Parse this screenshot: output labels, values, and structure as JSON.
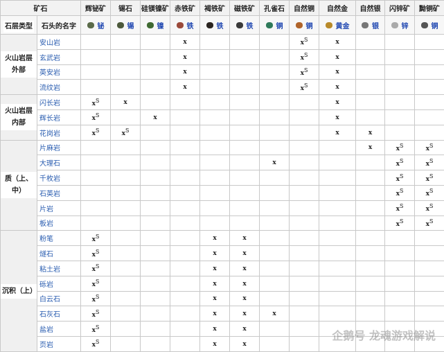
{
  "header": {
    "ore_label": "矿石",
    "ores": [
      "辉铋矿",
      "锡石",
      "硅镁镍矿",
      "赤铁矿",
      "褐铁矿",
      "磁铁矿",
      "孔雀石",
      "自然铜",
      "自然金",
      "自然银",
      "闪锌矿",
      "黝铜矿"
    ]
  },
  "subheader": {
    "layer_type": "石层类型",
    "rock_name": "石头的名字",
    "metals": [
      "铋",
      "锡",
      "镍",
      "铁",
      "铁",
      "铁",
      "铜",
      "铜",
      "黄金",
      "银",
      "锌",
      "铜"
    ],
    "icon_colors": [
      "#5b6b4a",
      "#4d5a3c",
      "#3f6a32",
      "#9b4a3a",
      "#2a2420",
      "#3a3a3a",
      "#2f7a5a",
      "#b0642a",
      "#b88a2a",
      "#777",
      "#aaa",
      "#555"
    ]
  },
  "groups": [
    {
      "label": "火山岩层外部",
      "rows": [
        {
          "name": "安山岩",
          "marks": [
            "",
            "",
            "",
            "x",
            "",
            "",
            "",
            "xS",
            "x",
            "",
            "",
            ""
          ]
        },
        {
          "name": "玄武岩",
          "marks": [
            "",
            "",
            "",
            "x",
            "",
            "",
            "",
            "xS",
            "x",
            "",
            "",
            ""
          ]
        },
        {
          "name": "英安岩",
          "marks": [
            "",
            "",
            "",
            "x",
            "",
            "",
            "",
            "xS",
            "x",
            "",
            "",
            ""
          ]
        },
        {
          "name": "流纹岩",
          "marks": [
            "",
            "",
            "",
            "x",
            "",
            "",
            "",
            "xS",
            "x",
            "",
            "",
            ""
          ]
        }
      ]
    },
    {
      "label": "火山岩层内部",
      "rows": [
        {
          "name": "闪长岩",
          "marks": [
            "xS",
            "x",
            "",
            "",
            "",
            "",
            "",
            "",
            "x",
            "",
            "",
            ""
          ]
        },
        {
          "name": "辉长岩",
          "marks": [
            "xS",
            "",
            "x",
            "",
            "",
            "",
            "",
            "",
            "x",
            "",
            "",
            ""
          ]
        },
        {
          "name": "花岗岩",
          "marks": [
            "xS",
            "xS",
            "",
            "",
            "",
            "",
            "",
            "",
            "x",
            "x",
            "",
            ""
          ]
        }
      ]
    },
    {
      "label": "质（上、中）",
      "rows": [
        {
          "name": "片麻岩",
          "marks": [
            "",
            "",
            "",
            "",
            "",
            "",
            "",
            "",
            "",
            "x",
            "xS",
            "xS"
          ]
        },
        {
          "name": "大理石",
          "marks": [
            "",
            "",
            "",
            "",
            "",
            "",
            "x",
            "",
            "",
            "",
            "xS",
            "xS"
          ]
        },
        {
          "name": "千枚岩",
          "marks": [
            "",
            "",
            "",
            "",
            "",
            "",
            "",
            "",
            "",
            "",
            "xS",
            "xS"
          ]
        },
        {
          "name": "石英岩",
          "marks": [
            "",
            "",
            "",
            "",
            "",
            "",
            "",
            "",
            "",
            "",
            "xS",
            "xS"
          ]
        },
        {
          "name": "片岩",
          "marks": [
            "",
            "",
            "",
            "",
            "",
            "",
            "",
            "",
            "",
            "",
            "xS",
            "xS"
          ]
        },
        {
          "name": "板岩",
          "marks": [
            "",
            "",
            "",
            "",
            "",
            "",
            "",
            "",
            "",
            "",
            "xS",
            "xS"
          ]
        }
      ]
    },
    {
      "label": "沉积（上）",
      "rows": [
        {
          "name": "粉笔",
          "marks": [
            "xS",
            "",
            "",
            "",
            "x",
            "x",
            "",
            "",
            "",
            "",
            "",
            ""
          ]
        },
        {
          "name": "燧石",
          "marks": [
            "xS",
            "",
            "",
            "",
            "x",
            "x",
            "",
            "",
            "",
            "",
            "",
            ""
          ]
        },
        {
          "name": "粘土岩",
          "marks": [
            "xS",
            "",
            "",
            "",
            "x",
            "x",
            "",
            "",
            "",
            "",
            "",
            ""
          ]
        },
        {
          "name": "砾岩",
          "marks": [
            "xS",
            "",
            "",
            "",
            "x",
            "x",
            "",
            "",
            "",
            "",
            "",
            ""
          ]
        },
        {
          "name": "白云石",
          "marks": [
            "xS",
            "",
            "",
            "",
            "x",
            "x",
            "",
            "",
            "",
            "",
            "",
            ""
          ]
        },
        {
          "name": "石灰石",
          "marks": [
            "xS",
            "",
            "",
            "",
            "x",
            "x",
            "x",
            "",
            "",
            "",
            "",
            ""
          ]
        },
        {
          "name": "盐岩",
          "marks": [
            "xS",
            "",
            "",
            "",
            "x",
            "x",
            "",
            "",
            "",
            "",
            "",
            ""
          ]
        },
        {
          "name": "页岩",
          "marks": [
            "xS",
            "",
            "",
            "",
            "x",
            "x",
            "",
            "",
            "",
            "",
            "",
            ""
          ]
        }
      ]
    }
  ],
  "watermark": "企鹅号 龙魂游戏解说"
}
